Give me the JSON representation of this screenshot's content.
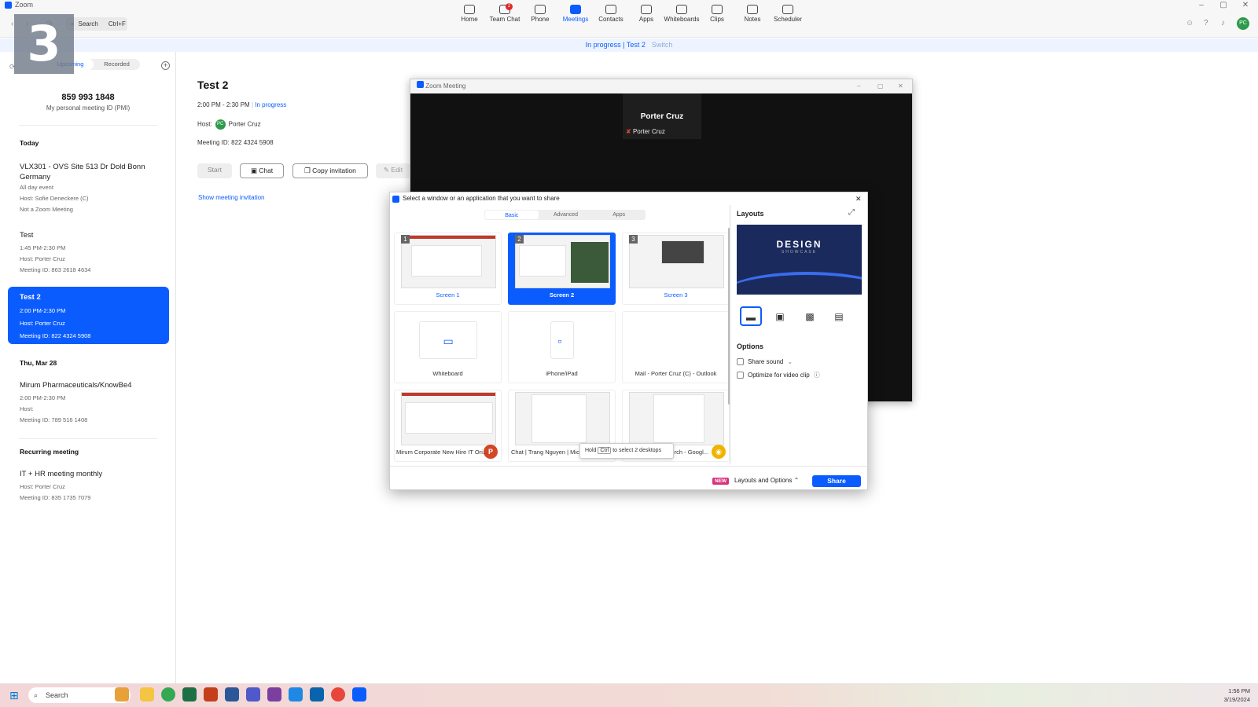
{
  "app": {
    "title": "Zoom"
  },
  "step_number": "3",
  "nav": {
    "search_label": "Search",
    "search_shortcut": "Ctrl+F",
    "items": [
      {
        "label": "Home",
        "badge": ""
      },
      {
        "label": "Team Chat",
        "badge": "2"
      },
      {
        "label": "Phone",
        "badge": ""
      },
      {
        "label": "Meetings",
        "badge": ""
      },
      {
        "label": "Contacts",
        "badge": ""
      },
      {
        "label": "Apps",
        "badge": ""
      },
      {
        "label": "Whiteboards",
        "badge": ""
      },
      {
        "label": "Clips",
        "badge": ""
      },
      {
        "label": "Notes",
        "badge": ""
      },
      {
        "label": "Scheduler",
        "badge": ""
      }
    ],
    "avatar_initials": "PC"
  },
  "banner": {
    "status": "In progress | Test 2",
    "switch": "Switch"
  },
  "sidebar": {
    "tabs": [
      "Upcoming",
      "Recorded"
    ],
    "pmi_number": "859 993 1848",
    "pmi_label": "My personal meeting ID (PMI)",
    "sections": {
      "today": "Today",
      "thu": "Thu, Mar 28",
      "recurring": "Recurring meeting"
    },
    "meetings": [
      {
        "title": "VLX301 - OVS Site 513 Dr Dold Bonn Germany",
        "line1": "All day event",
        "line2": "Host: Sofie Deneckere (C)",
        "line3": "Not a Zoom Meeting"
      },
      {
        "title": "Test",
        "line1": "1:45 PM-2:30 PM",
        "line2": "Host: Porter Cruz",
        "line3": "Meeting ID: 863 2618 4634"
      },
      {
        "title": "Test 2",
        "line1": "2:00 PM-2:30 PM",
        "line2": "Host: Porter Cruz",
        "line3": "Meeting ID: 822 4324 5908"
      },
      {
        "title": "Mirum Pharmaceuticals/KnowBe4",
        "line1": "2:00 PM-2:30 PM",
        "line2": "Host:",
        "line3": "Meeting ID: 789 516 1408"
      },
      {
        "title": "IT + HR meeting monthly",
        "line1": "Host: Porter Cruz",
        "line2": "Meeting ID: 835 1735 7079",
        "line3": ""
      }
    ]
  },
  "detail": {
    "title": "Test 2",
    "time": "2:00 PM - 2:30 PM",
    "status": "In progress",
    "host_label": "Host:",
    "host_name": "Porter Cruz",
    "meeting_id": "Meeting ID: 822 4324 5908",
    "buttons": {
      "start": "Start",
      "chat": "Chat",
      "copy": "Copy invitation",
      "edit": "Edit"
    },
    "show_invitation": "Show meeting invitation"
  },
  "meeting_window": {
    "title": "Zoom Meeting",
    "participant_name": "Porter Cruz",
    "participant_label": "Porter Cruz"
  },
  "share_dialog": {
    "title": "Select a window or an application that you want to share",
    "tabs": [
      "Basic",
      "Advanced",
      "Apps"
    ],
    "items": [
      {
        "label": "Screen 1",
        "num": "1"
      },
      {
        "label": "Screen 2",
        "num": "2"
      },
      {
        "label": "Screen 3",
        "num": "3"
      },
      {
        "label": "Whiteboard"
      },
      {
        "label": "iPhone/iPad"
      },
      {
        "label": "Mail - Porter Cruz (C) - Outlook"
      },
      {
        "label": "Mirum Corporate New Hire IT Ori..."
      },
      {
        "label": "Chat | Trang Nguyen | Micr"
      },
      {
        "label": "rch - Googl..."
      }
    ],
    "tooltip": {
      "pre": "Hold",
      "key": "Ctrl",
      "post": "to select 2 desktops"
    },
    "layouts_title": "Layouts",
    "preview_title": "DESIGN",
    "preview_sub": "SHOWCASE",
    "options_title": "Options",
    "share_sound": "Share sound",
    "optimize": "Optimize for video clip",
    "new_badge": "NEW",
    "layouts_options": "Layouts and Options",
    "share_button": "Share"
  },
  "taskbar": {
    "search": "Search",
    "time": "1:56 PM",
    "date": "3/19/2024"
  }
}
